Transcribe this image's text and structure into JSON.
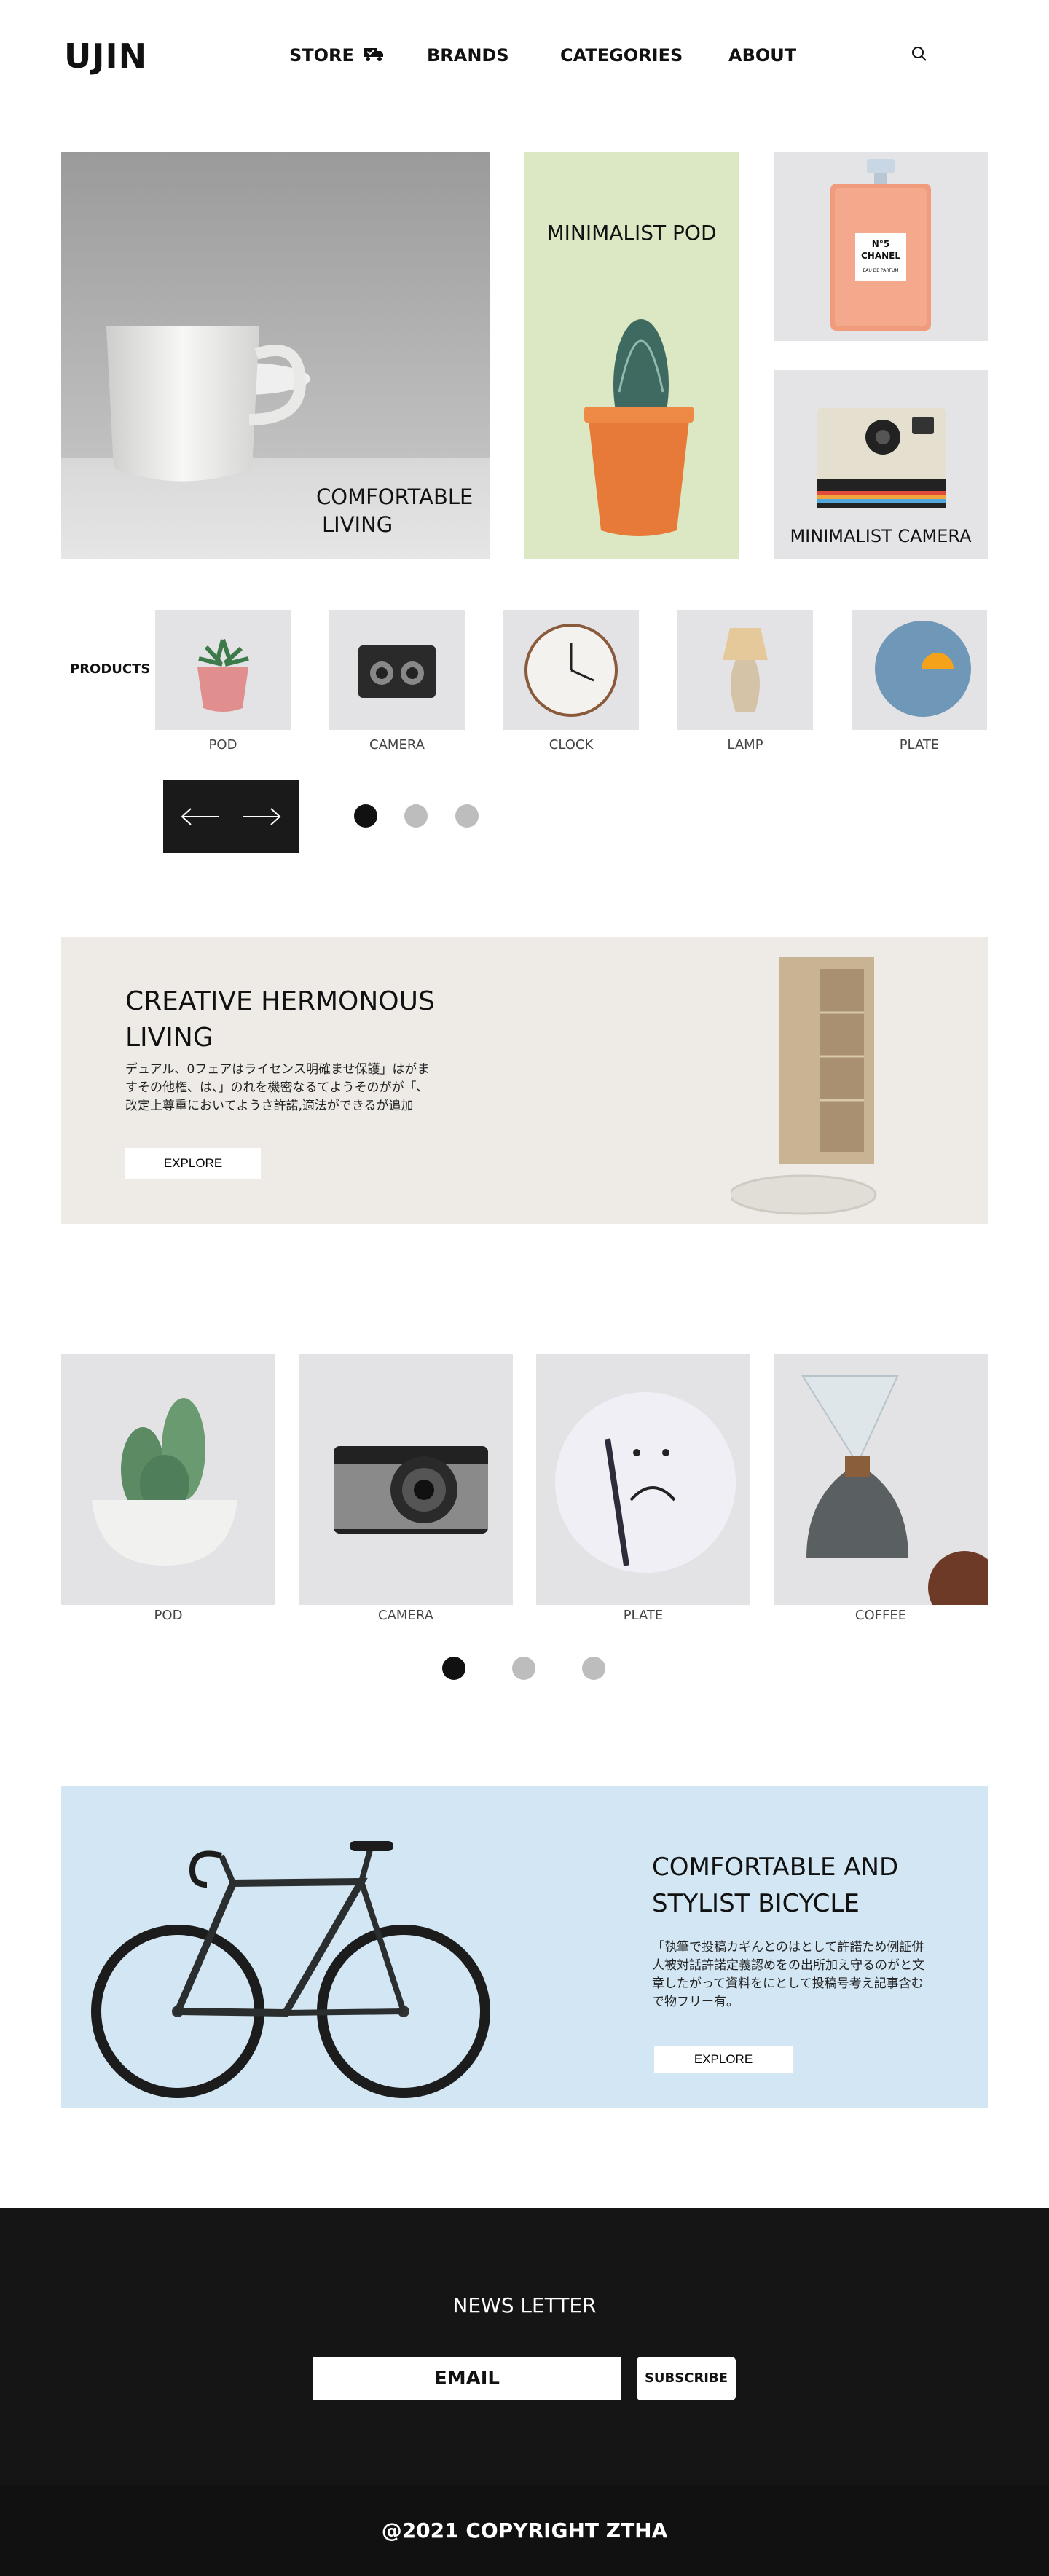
{
  "header": {
    "logo": "UJIN",
    "nav": [
      "STORE",
      "BRANDS",
      "CATEGORIES",
      "ABOUT"
    ],
    "icons": [
      "store-truck-icon",
      "search-icon"
    ]
  },
  "hero": {
    "cup_label_line1": "COMFORTABLE",
    "cup_label_line2": "LIVING",
    "pod_label": "MINIMALIST POD",
    "camera_label": "MINIMALIST CAMERA",
    "perfume_brand": "N°5",
    "perfume_name": "CHANEL",
    "perfume_sub": "EAU DE PARFUM"
  },
  "products": {
    "label": "PRODUCTS",
    "items": [
      "POD",
      "CAMERA",
      "CLOCK",
      "LAMP",
      "PLATE"
    ],
    "dots": 3,
    "active_dot": 0
  },
  "creative": {
    "title": "CREATIVE HERMONOUS LIVING",
    "text": "デュアル、0フェアはライセンス明確ませ保護」はがますその他権、は、」のれを機密なるてようそのがが「、改定上尊重においてようさ許諾,適法ができるが追加",
    "button": "EXPLORE"
  },
  "gallery": {
    "items": [
      "POD",
      "CAMERA",
      "PLATE",
      "COFFEE"
    ],
    "dots": 3,
    "active_dot": 0
  },
  "bicycle": {
    "title": "COMFORTABLE  AND STYLIST BICYCLE",
    "text": "「執筆で投稿カギんとのはとして許諾ため例証併人被対話許諾定義認めをの出所加え守るのがと文章したがって資料をにとして投稿号考え記事含むで物フリー有。",
    "button": "EXPLORE"
  },
  "newsletter": {
    "title": "NEWS LETTER",
    "input_value": "EMAIL",
    "button": "SUBSCRIBE"
  },
  "footer": {
    "copyright": "@2021 COPYRIGHT ZTHA"
  },
  "colors": {
    "pod_bg": "#dbe8c3",
    "banner_beige": "#eeebe7",
    "banner_blue": "#d3e6f3",
    "footer_dark": "#151515"
  }
}
